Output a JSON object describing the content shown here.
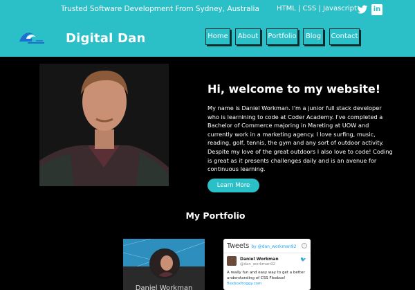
{
  "topbar": {
    "tagline": "Trusted Software Development From Sydney, Australia",
    "tech": "HTML | CSS | Javascript",
    "twitter_icon": "twitter-icon",
    "linkedin_label": "in"
  },
  "header": {
    "brand": "Digital Dan",
    "logo_icon": "wave-icon",
    "nav": [
      {
        "label": "Home"
      },
      {
        "label": "About"
      },
      {
        "label": "Portfolio"
      },
      {
        "label": "Blog"
      },
      {
        "label": "Contact"
      }
    ]
  },
  "hero": {
    "title": "Hi, welcome to my website!",
    "text": "My name is Daniel Workman. I'm a junior full stack developer who is learnining to code at Coder Academy. I've completed a Bachelor of Commerce majoring in Mareting at UOW and currently work in a marketing agency. I love surfing, music, reading, golf, tennis, the gym and any sort of outdoor activity. Despite my love of the great outdoors I also love to code! Coding is great as it presents challenges daily and is an avenue for continuous learning.",
    "button": "Learn More"
  },
  "portfolio": {
    "title": "My Portfolio",
    "card1_name": "Daniel Workman"
  },
  "tweets": {
    "title": "Tweets",
    "by": "by @dan_workman92",
    "name": "Daniel Workman",
    "handle": "@dan_workman92",
    "text": "A really fun and easy way to get a better understanding of CSS Flexbox!",
    "link": "flexboxfroggy.com"
  },
  "colors": {
    "accent": "#2bbfc7",
    "background": "#000000"
  }
}
